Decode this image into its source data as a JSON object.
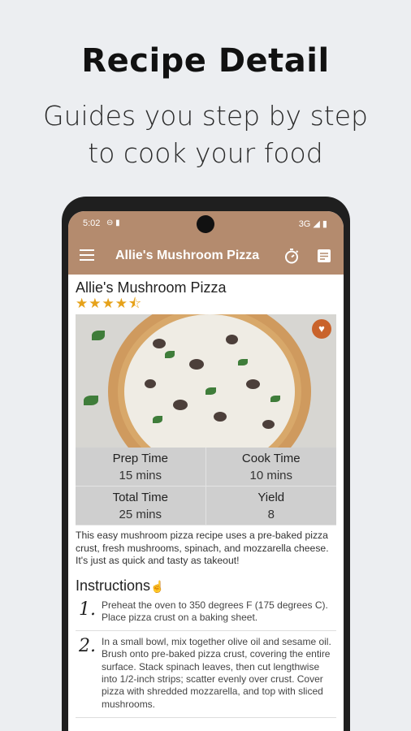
{
  "promo": {
    "title": "Recipe Detail",
    "subtitle_line1": "Guides you step by step",
    "subtitle_line2": "to cook your food"
  },
  "statusbar": {
    "time": "5:02",
    "left_icons": "⊖ ▮",
    "right": "3G ◢ ▮"
  },
  "appbar": {
    "title": "Allie's Mushroom Pizza",
    "icons": [
      "menu-icon",
      "timer-icon",
      "notes-icon"
    ]
  },
  "recipe": {
    "title": "Allie's Mushroom Pizza",
    "rating": 4.5,
    "stars": "★★★★⯪",
    "favorite_icon": "heart-icon",
    "info": [
      {
        "label": "Prep Time",
        "value": "15 mins"
      },
      {
        "label": "Cook Time",
        "value": "10 mins"
      },
      {
        "label": "Total Time",
        "value": "25 mins"
      },
      {
        "label": "Yield",
        "value": "8"
      }
    ],
    "description": "This easy mushroom pizza recipe uses a pre-baked pizza crust, fresh mushrooms, spinach, and mozzarella cheese. It's just as quick and tasty as takeout!"
  },
  "instructions": {
    "heading": "Instructions",
    "steps": [
      {
        "num": "1.",
        "text": "Preheat the oven to 350 degrees F (175 degrees C). Place pizza crust on a baking sheet."
      },
      {
        "num": "2.",
        "text": "In a small bowl, mix together olive oil and sesame oil. Brush onto pre-baked pizza crust, covering the entire surface. Stack spinach leaves, then cut lengthwise into 1/2-inch strips; scatter evenly over crust. Cover pizza with shredded mozzarella, and top with sliced mushrooms."
      }
    ]
  },
  "colors": {
    "brand": "#b48b6e",
    "star": "#e6a21a",
    "favorite": "#c9632b"
  }
}
